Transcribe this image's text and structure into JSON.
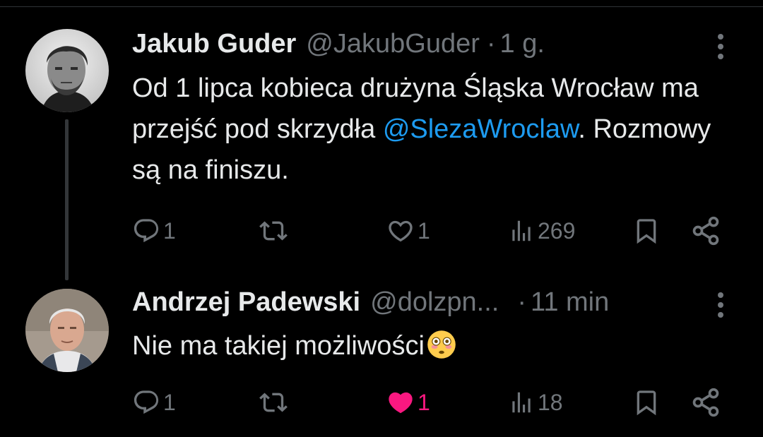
{
  "tweets": [
    {
      "display_name": "Jakub Guder",
      "handle": "@JakubGuder",
      "separator": "·",
      "time": "1 g.",
      "text_before": "Od 1 lipca kobieca drużyna Śląska Wrocław ma przejść pod skrzydła ",
      "mention": "@SlezaWroclaw",
      "text_after": ". Rozmowy są na finiszu.",
      "replies": "1",
      "retweets": "",
      "likes": "1",
      "liked": false,
      "views": "269",
      "avatar_icon": "avatar-photo-man-dark-hair"
    },
    {
      "display_name": "Andrzej Padewski",
      "handle": "@dolzpn...",
      "separator": "·",
      "time": "11 min",
      "text": "Nie ma takiej możliwości",
      "emoji": "flushed-face-emoji",
      "replies": "1",
      "retweets": "",
      "likes": "1",
      "liked": true,
      "views": "18",
      "avatar_icon": "avatar-photo-man-gray-hair"
    }
  ],
  "colors": {
    "background": "#000000",
    "text": "#e7e9ea",
    "secondary": "#71767b",
    "link": "#1d9bf0",
    "like": "#f91880",
    "thread_line": "#333639"
  }
}
